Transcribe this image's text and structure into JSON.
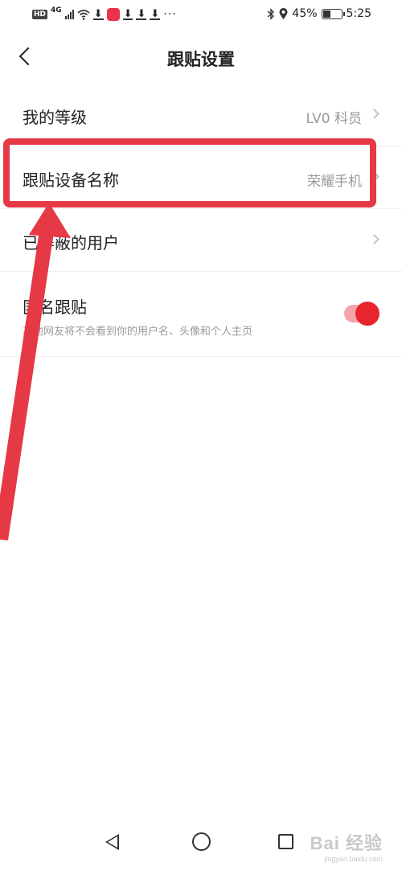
{
  "status_bar": {
    "hd": "HD",
    "network": "4G",
    "battery": "45%",
    "battery_level": 0.45,
    "time": "5:25",
    "overflow": "···",
    "left_icons": [
      "hd-icon",
      "signal-icon",
      "wifi-icon",
      "download-icon",
      "app-notification-icon",
      "download-icon",
      "download-icon",
      "download-icon"
    ],
    "right_icons": [
      "bluetooth-icon",
      "location-icon",
      "battery-icon"
    ]
  },
  "header": {
    "title": "跟贴设置"
  },
  "settings": {
    "level": {
      "label": "我的等级",
      "value": "LV0 科员"
    },
    "device_name": {
      "label": "跟贴设备名称",
      "value": "荣耀手机"
    },
    "blocked_users": {
      "label": "已屏蔽的用户"
    },
    "anonymous": {
      "label": "匿名跟贴",
      "description": "其他网友将不会看到你的用户名、头像和个人主页",
      "enabled": true
    }
  },
  "colors": {
    "accent": "#e6252c",
    "annotation": "#e63946"
  },
  "watermark": {
    "main": "Bai 经验",
    "url": "jingyan.baidu.com"
  }
}
